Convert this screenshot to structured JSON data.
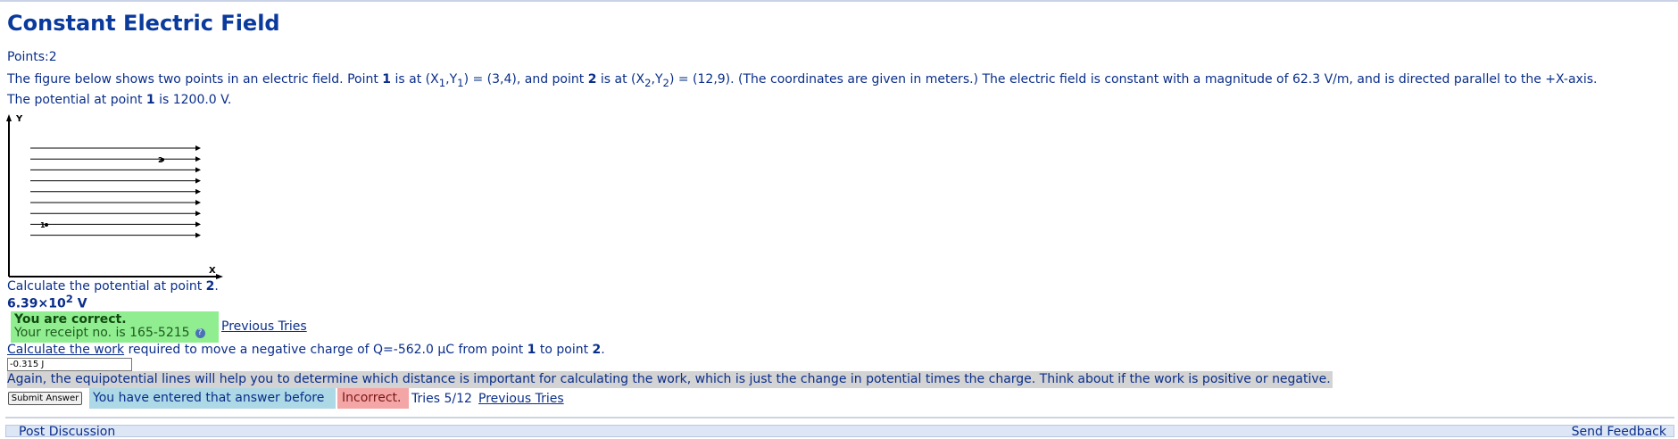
{
  "page": {
    "title": "Constant Electric Field",
    "points_label": "Points:2"
  },
  "problem": {
    "p1": "The figure below shows two points in an electric field. Point ",
    "point1": "1",
    "p2": " is at (X",
    "sub1a": "1",
    "p3": ",Y",
    "sub1b": "1",
    "p4": ") = (3,4), and point ",
    "point2": "2",
    "p5": " is at (X",
    "sub2a": "2",
    "p6": ",Y",
    "sub2b": "2",
    "p7": ") = (12,9). (The coordinates are given in meters.) The electric field is constant with a magnitude of 62.3 V/m, and is directed parallel to the +X-axis.",
    "p8": "The potential at point ",
    "point1b": "1",
    "p9": " is 1200.0 V."
  },
  "figure": {
    "y_axis_label": "Y",
    "x_axis_label": "X",
    "point1_label": "1",
    "point2_label": "2",
    "field_line_count": 9
  },
  "part1": {
    "question_text": "Calculate the potential at point ",
    "question_point": "2",
    "question_end": ".",
    "answer_mantissa": "6.39×10",
    "answer_exponent": "2",
    "answer_unit": " V",
    "correct_title": "You are correct.",
    "receipt_text": "Your receipt no. is 165-5215",
    "help_icon": "?",
    "previous_tries": "Previous Tries"
  },
  "part2": {
    "question_link": "Calculate the work",
    "question_text": " required to move a negative charge of Q=-562.0 μC from point ",
    "question_point1": "1",
    "question_mid": " to point ",
    "question_point2": "2",
    "question_end": ".",
    "input_value": "-0.315 J",
    "hint": "Again, the equipotential lines will help you to determine which distance is important for calculating the work, which is just the change in potential times the charge. Think about if the work is positive or negative.",
    "submit_label": "Submit Answer",
    "entered_before": "You have entered that answer before",
    "incorrect": "Incorrect.",
    "tries": "Tries 5/12",
    "previous_tries": "Previous Tries"
  },
  "footer": {
    "left": "Post Discussion",
    "right": "Send Feedback"
  },
  "colors": {
    "text": "#0a2e8a",
    "correct_bg": "#90ee90",
    "incorrect_bg": "#f4a6a6",
    "entered_bg": "#add8e6",
    "hint_bg": "#d3d3d3"
  }
}
